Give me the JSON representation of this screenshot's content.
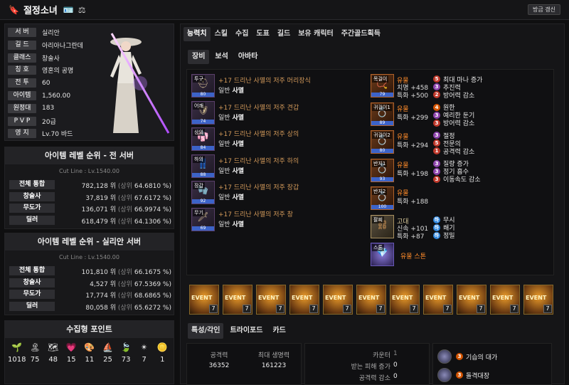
{
  "header": {
    "name": "절정소녀",
    "refresh_label": "방금 갱신"
  },
  "profile": {
    "rows": [
      {
        "label": "서 버",
        "value": "실리안"
      },
      {
        "label": "길 드",
        "value": "아리아나그란데"
      },
      {
        "label": "클래스",
        "value": "창술사"
      },
      {
        "label": "칭 호",
        "value": "영혼의 공명"
      },
      {
        "label": "전 투",
        "value": "60"
      },
      {
        "label": "아이템",
        "value": "1,560.00"
      },
      {
        "label": "원정대",
        "value": "183"
      },
      {
        "label": "P V P",
        "value": "20급"
      },
      {
        "label": "영 지",
        "value": "Lv.70 바드"
      }
    ]
  },
  "rank_all": {
    "title": "아이템 레벨 순위 - 전 서버",
    "cutline": "Cut Line : Lv.1540.00",
    "rows": [
      {
        "label": "전체 통합",
        "rank": "782,128 위",
        "top": "(상위",
        "pct": "64.6810 %)"
      },
      {
        "label": "창술사",
        "rank": "37,819 위",
        "top": "(상위",
        "pct": "67.6172 %)"
      },
      {
        "label": "무도가",
        "rank": "136,071 위",
        "top": "(상위",
        "pct": "66.9974 %)"
      },
      {
        "label": "딜러",
        "rank": "618,479 위",
        "top": "(상위",
        "pct": "64.1306 %)"
      }
    ]
  },
  "rank_server": {
    "title": "아이템 레벨 순위 - 실리안 서버",
    "cutline": "Cut Line : Lv.1540.00",
    "rows": [
      {
        "label": "전체 통합",
        "rank": "101,810 위",
        "top": "(상위",
        "pct": "66.1675 %)"
      },
      {
        "label": "창술사",
        "rank": "4,527 위",
        "top": "(상위",
        "pct": "67.5369 %)"
      },
      {
        "label": "무도가",
        "rank": "17,774 위",
        "top": "(상위",
        "pct": "68.6865 %)"
      },
      {
        "label": "딜러",
        "rank": "80,058 위",
        "top": "(상위",
        "pct": "65.6272 %)"
      }
    ]
  },
  "collect": {
    "title": "수집형 포인트",
    "items": [
      {
        "icon": "seed-icon",
        "value": "1018"
      },
      {
        "icon": "island-icon",
        "value": "75"
      },
      {
        "icon": "map-icon",
        "value": "48"
      },
      {
        "icon": "heart-icon",
        "value": "15"
      },
      {
        "icon": "art-icon",
        "value": "11"
      },
      {
        "icon": "voyage-icon",
        "value": "25"
      },
      {
        "icon": "leaf-icon",
        "value": "73"
      },
      {
        "icon": "star-icon",
        "value": "7"
      },
      {
        "icon": "coin-icon",
        "value": "1"
      }
    ]
  },
  "tabs": [
    "능력치",
    "스킬",
    "수집",
    "도표",
    "길드",
    "보유 캐릭터",
    "주간골드획득"
  ],
  "subtabs": [
    "장비",
    "보석",
    "아바타"
  ],
  "equipment": [
    {
      "slot": "투구",
      "name": "+17 드리난 사멸의 저주 머리장식",
      "grade": "일반",
      "set": "사멸",
      "q": "80"
    },
    {
      "slot": "어깨",
      "name": "+17 드리난 사멸의 저주 견갑",
      "grade": "일반",
      "set": "사멸",
      "q": "74"
    },
    {
      "slot": "상의",
      "name": "+17 드리난 사멸의 저주 상의",
      "grade": "일반",
      "set": "사멸",
      "q": "84"
    },
    {
      "slot": "하의",
      "name": "+17 드리난 사멸의 저주 하의",
      "grade": "일반",
      "set": "사멸",
      "q": "88"
    },
    {
      "slot": "장갑",
      "name": "+17 드리난 사멸의 저주 장갑",
      "grade": "일반",
      "set": "사멸",
      "q": "92"
    },
    {
      "slot": "무기",
      "name": "+17 드리난 사멸의 저주 창",
      "grade": "일반",
      "set": "사멸",
      "q": "69"
    }
  ],
  "accessories": [
    {
      "slot": "목걸이",
      "grade": "유물",
      "stats": [
        "치명 +458",
        "특화 +500"
      ],
      "q": "79",
      "eng": [
        {
          "n": "5",
          "c": "#c0392b",
          "t": "최대 마나 증가"
        },
        {
          "n": "3",
          "c": "#8e44ad",
          "t": "추진력"
        },
        {
          "n": "2",
          "c": "#c0392b",
          "t": "방어력 감소"
        }
      ]
    },
    {
      "slot": "귀걸이1",
      "grade": "유물",
      "stats": [
        "특화 +299"
      ],
      "q": "89",
      "eng": [
        {
          "n": "4",
          "c": "#d35400",
          "t": "원한"
        },
        {
          "n": "3",
          "c": "#8e44ad",
          "t": "예리한 둔기"
        },
        {
          "n": "3",
          "c": "#c0392b",
          "t": "방어력 감소"
        }
      ]
    },
    {
      "slot": "귀걸이2",
      "grade": "유물",
      "stats": [
        "특화 +294"
      ],
      "q": "80",
      "eng": [
        {
          "n": "3",
          "c": "#8e44ad",
          "t": "절정"
        },
        {
          "n": "5",
          "c": "#c0392b",
          "t": "전문의"
        },
        {
          "n": "1",
          "c": "#c0392b",
          "t": "공격력 감소"
        }
      ]
    },
    {
      "slot": "반지1",
      "grade": "유물",
      "stats": [
        "특화 +198"
      ],
      "q": "93",
      "eng": [
        {
          "n": "3",
          "c": "#8e44ad",
          "t": "질량 증가"
        },
        {
          "n": "3",
          "c": "#8e44ad",
          "t": "정기 흡수"
        },
        {
          "n": "3",
          "c": "#c0392b",
          "t": "이동속도 감소"
        }
      ]
    },
    {
      "slot": "반지2",
      "grade": "유물",
      "stats": [
        "특화 +188"
      ],
      "q": "100",
      "eng": []
    },
    {
      "slot": "팔찌",
      "grade": "고대",
      "stats": [
        "신속 +101",
        "특화 +87"
      ],
      "q": "",
      "eng": [
        {
          "n": "하",
          "c": "#2e86de",
          "t": "무시"
        },
        {
          "n": "하",
          "c": "#2e86de",
          "t": "쐐기"
        },
        {
          "n": "하",
          "c": "#2e86de",
          "t": "정밀"
        }
      ]
    }
  ],
  "stone": {
    "slot": "스톤",
    "name": "유물 스톤"
  },
  "events": [
    {
      "label": "EVENT",
      "level": "7"
    },
    {
      "label": "EVENT",
      "level": "7"
    },
    {
      "label": "EVENT",
      "level": "7"
    },
    {
      "label": "EVENT",
      "level": "7"
    },
    {
      "label": "EVENT",
      "level": "7"
    },
    {
      "label": "EVENT",
      "level": "7"
    },
    {
      "label": "EVENT",
      "level": "7"
    },
    {
      "label": "EVENT",
      "level": "7"
    },
    {
      "label": "EVENT",
      "level": "7"
    },
    {
      "label": "EVENT",
      "level": "7"
    },
    {
      "label": "EVENT",
      "level": "7"
    }
  ],
  "bottom_tabs": [
    "특성/각인",
    "트라이포드",
    "카드"
  ],
  "stats": {
    "attack_label": "공격력",
    "attack_value": "36352",
    "hp_label": "최대 생명력",
    "hp_value": "161223",
    "counter_label": "카운터",
    "counter_value": "1",
    "dmg_taken_label": "받는 피해 증가",
    "dmg_taken_value": "0",
    "atk_down_label": "공격력 감소",
    "atk_down_value": "0"
  },
  "engravings": [
    {
      "level": "3",
      "name": "기습의 대가"
    },
    {
      "level": "3",
      "name": "돌격대장"
    }
  ],
  "colors": {
    "accent": "#d39a5a",
    "relic": "#ff8b2a",
    "quality_blue": "#3c63c8"
  }
}
